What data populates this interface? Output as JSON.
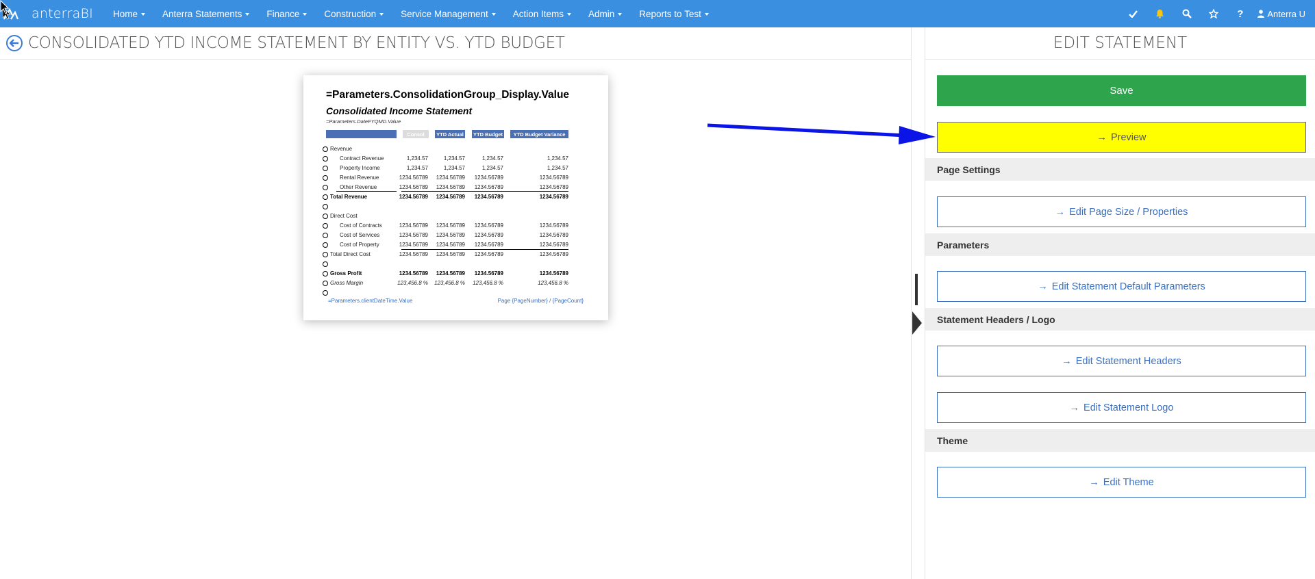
{
  "app": {
    "brand": "anterraBI",
    "nav": [
      {
        "label": "Home"
      },
      {
        "label": "Anterra Statements"
      },
      {
        "label": "Finance"
      },
      {
        "label": "Construction"
      },
      {
        "label": "Service Management"
      },
      {
        "label": "Action Items"
      },
      {
        "label": "Admin"
      },
      {
        "label": "Reports to Test"
      }
    ],
    "icons": [
      "check-icon",
      "bell-icon",
      "search-icon",
      "star-icon",
      "help-icon"
    ],
    "user": "Anterra U",
    "colors": {
      "nav_bg": "#3a8fe0",
      "save_green": "#2ea54d",
      "highlight_yellow": "#ffff00",
      "link_blue": "#3a6fc0",
      "annotation_blue": "#0a14e6"
    }
  },
  "page": {
    "title": "CONSOLIDATED YTD INCOME STATEMENT BY ENTITY VS. YTD BUDGET"
  },
  "preview": {
    "title_expr": "=Parameters.ConsolidationGroup_Display.Value",
    "subtitle": "Consolidated Income Statement",
    "date_expr": "=Parameters.DateFYQMD.Value",
    "columns": [
      "Consol",
      "YTD Actual",
      "YTD Budget",
      "YTD Budget Variance"
    ],
    "rows": [
      {
        "label": "Revenue",
        "values": [
          "",
          "",
          "",
          ""
        ]
      },
      {
        "label": "Contract Revenue",
        "values": [
          "1,234.57",
          "1,234.57",
          "1,234.57",
          "1,234.57"
        ]
      },
      {
        "label": "Property Income",
        "values": [
          "1,234.57",
          "1,234.57",
          "1,234.57",
          "1,234.57"
        ]
      },
      {
        "label": "Rental Revenue",
        "values": [
          "1234.56789",
          "1234.56789",
          "1234.56789",
          "1234.56789"
        ]
      },
      {
        "label": "Other Revenue",
        "values": [
          "1234.56789",
          "1234.56789",
          "1234.56789",
          "1234.56789"
        ]
      },
      {
        "label": "Total Revenue",
        "values": [
          "1234.56789",
          "1234.56789",
          "1234.56789",
          "1234.56789"
        ]
      },
      {
        "label": "",
        "values": [
          "",
          "",
          "",
          ""
        ]
      },
      {
        "label": "Direct Cost",
        "values": [
          "",
          "",
          "",
          ""
        ]
      },
      {
        "label": "Cost of Contracts",
        "values": [
          "1234.56789",
          "1234.56789",
          "1234.56789",
          "1234.56789"
        ]
      },
      {
        "label": "Cost of Services",
        "values": [
          "1234.56789",
          "1234.56789",
          "1234.56789",
          "1234.56789"
        ]
      },
      {
        "label": "Cost of Property",
        "values": [
          "1234.56789",
          "1234.56789",
          "1234.56789",
          "1234.56789"
        ]
      },
      {
        "label": "Total Direct Cost",
        "values": [
          "1234.56789",
          "1234.56789",
          "1234.56789",
          "1234.56789"
        ]
      },
      {
        "label": "",
        "values": [
          "",
          "",
          "",
          ""
        ]
      },
      {
        "label": "Gross Profit",
        "values": [
          "1234.56789",
          "1234.56789",
          "1234.56789",
          "1234.56789"
        ]
      },
      {
        "label": "Gross Margin",
        "values": [
          "123,456.8 %",
          "123,456.8 %",
          "123,456.8 %",
          "123,456.8 %"
        ]
      },
      {
        "label": "",
        "values": [
          "",
          "",
          "",
          ""
        ]
      }
    ],
    "footer_left": "=Parameters.clientDateTime.Value",
    "footer_right": "Page {PageNumber} / {PageCount}"
  },
  "panel": {
    "title": "EDIT STATEMENT",
    "save": "Save",
    "preview": "Preview",
    "sections": {
      "page_settings": "Page Settings",
      "parameters": "Parameters",
      "headers_logo": "Statement Headers / Logo",
      "theme": "Theme"
    },
    "buttons": {
      "page_size": "Edit Page Size / Properties",
      "default_params": "Edit Statement Default Parameters",
      "headers": "Edit Statement Headers",
      "logo": "Edit Statement Logo",
      "theme": "Edit Theme"
    }
  }
}
